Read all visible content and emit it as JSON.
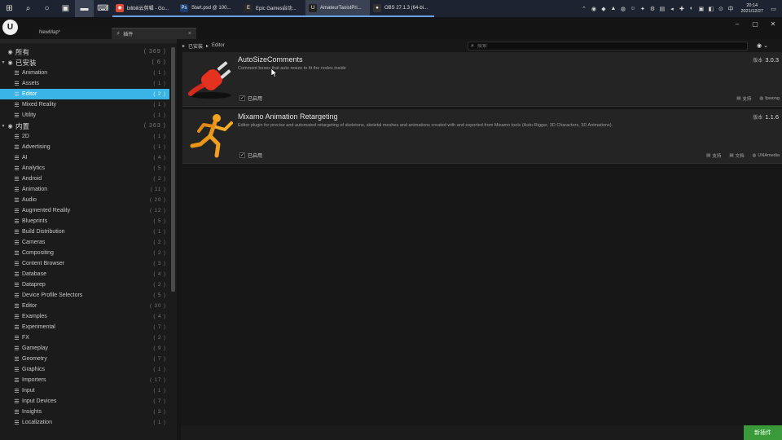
{
  "taskbar": {
    "apps": [
      {
        "label": "bilibili云剪辑 - Go...",
        "color": "#dd4b39",
        "glyph": "◉"
      },
      {
        "label": "Start.psd @ 100...",
        "color": "#1b3f73",
        "glyph": "Ps"
      },
      {
        "label": "Epic Games启动...",
        "color": "#2a2a2a",
        "glyph": "E"
      },
      {
        "label": "AmateurTaoistPri...",
        "color": "#222",
        "glyph": "U"
      },
      {
        "label": "OBS 27.1.3 (64-bi...",
        "color": "#333",
        "glyph": "●"
      }
    ],
    "time": "20:14",
    "date": "2021/12/27"
  },
  "editor": {
    "tabs": {
      "map": "NewMap*",
      "plugins": "插件"
    }
  },
  "sidebar": {
    "categories": [
      {
        "label": "所有",
        "count": "( 369 )",
        "top": true,
        "arrow": ""
      },
      {
        "label": "已安装",
        "count": "( 6 )",
        "top": true,
        "arrow": "▾"
      },
      {
        "label": "Animation",
        "count": "( 1 )"
      },
      {
        "label": "Assets",
        "count": "( 1 )"
      },
      {
        "label": "Editor",
        "count": "( 2 )",
        "selected": true
      },
      {
        "label": "Mixed Reality",
        "count": "( 1 )"
      },
      {
        "label": "Utility",
        "count": "( 1 )"
      },
      {
        "label": "内置",
        "count": "( 363 )",
        "top": true,
        "arrow": "▾"
      },
      {
        "label": "2D",
        "count": "( 1 )"
      },
      {
        "label": "Advertising",
        "count": "( 1 )"
      },
      {
        "label": "AI",
        "count": "( 4 )"
      },
      {
        "label": "Analytics",
        "count": "( 5 )"
      },
      {
        "label": "Android",
        "count": "( 2 )"
      },
      {
        "label": "Animation",
        "count": "( 11 )"
      },
      {
        "label": "Audio",
        "count": "( 20 )"
      },
      {
        "label": "Augmented Reality",
        "count": "( 12 )"
      },
      {
        "label": "Blueprints",
        "count": "( 5 )"
      },
      {
        "label": "Build Distribution",
        "count": "( 1 )"
      },
      {
        "label": "Cameras",
        "count": "( 2 )"
      },
      {
        "label": "Compositing",
        "count": "( 2 )"
      },
      {
        "label": "Content Browser",
        "count": "( 3 )"
      },
      {
        "label": "Database",
        "count": "( 4 )"
      },
      {
        "label": "Dataprep",
        "count": "( 2 )"
      },
      {
        "label": "Device Profile Selectors",
        "count": "( 5 )"
      },
      {
        "label": "Editor",
        "count": "( 30 )"
      },
      {
        "label": "Examples",
        "count": "( 4 )"
      },
      {
        "label": "Experimental",
        "count": "( 7 )"
      },
      {
        "label": "FX",
        "count": "( 2 )"
      },
      {
        "label": "Gameplay",
        "count": "( 9 )"
      },
      {
        "label": "Geometry",
        "count": "( 7 )"
      },
      {
        "label": "Graphics",
        "count": "( 1 )"
      },
      {
        "label": "Importers",
        "count": "( 17 )"
      },
      {
        "label": "Input",
        "count": "( 1 )"
      },
      {
        "label": "Input Devices",
        "count": "( 7 )"
      },
      {
        "label": "Insights",
        "count": "( 3 )"
      },
      {
        "label": "Localization",
        "count": "( 1 )"
      }
    ]
  },
  "main": {
    "breadcrumb": {
      "root": "已安装",
      "current": "Editor"
    },
    "search_placeholder": "搜索",
    "plugins": [
      {
        "name": "AutoSizeComments",
        "description": "Comment boxes that auto resize to fit the nodes inside",
        "version_label": "版本",
        "version": "3.0.3",
        "enabled_label": "已启用",
        "actions": [
          "支持",
          "fpwong"
        ]
      },
      {
        "name": "Mixamo Animation Retargeting",
        "description": "Editor plugin for precise and automated retargeting of skeletons, skeletal meshes and animations created with and exported from Mixamo tools (Auto-Rigger, 3D Characters, 3D Animations).",
        "version_label": "版本",
        "version": "1.1.6",
        "enabled_label": "已启用",
        "actions": [
          "支持",
          "文档",
          "UNAmedia"
        ]
      }
    ],
    "new_plugin_label": "新插件"
  }
}
